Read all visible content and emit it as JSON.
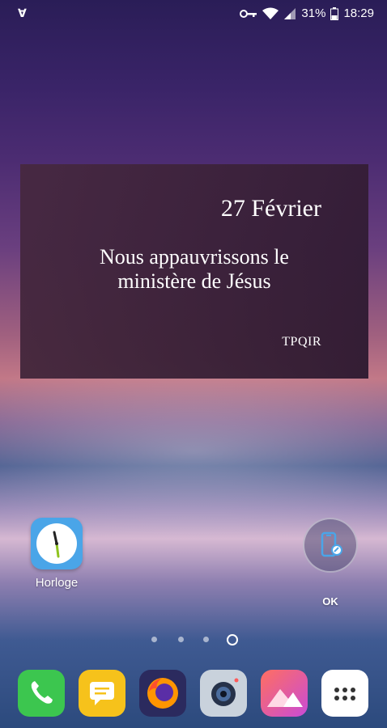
{
  "status_bar": {
    "left_badge": "∀",
    "battery_percent": "31%",
    "time": "18:29",
    "icons": [
      "key-icon",
      "wifi-icon",
      "signal-icon",
      "battery-icon"
    ]
  },
  "widget": {
    "date": "27 Février",
    "quote_line1": "Nous appauvrissons le",
    "quote_line2": "ministère de Jésus",
    "source": "TPQIR"
  },
  "home_apps": [
    {
      "label": "Horloge",
      "icon": "clock-icon"
    },
    {
      "label": "OK",
      "icon": "phone-shortcut-icon"
    }
  ],
  "page_indicator": {
    "count": 4,
    "active_index": 3
  },
  "dock": [
    {
      "icon": "phone-icon",
      "color": "#3cc64f"
    },
    {
      "icon": "messages-icon",
      "color": "#f6c21b"
    },
    {
      "icon": "firefox-icon",
      "color": "#2b2a5e"
    },
    {
      "icon": "camera-icon",
      "color": "#c9d2dc"
    },
    {
      "icon": "gallery-icon",
      "color": "#ff4c6a"
    },
    {
      "icon": "apps-drawer-icon",
      "color": "#ffffff"
    }
  ]
}
